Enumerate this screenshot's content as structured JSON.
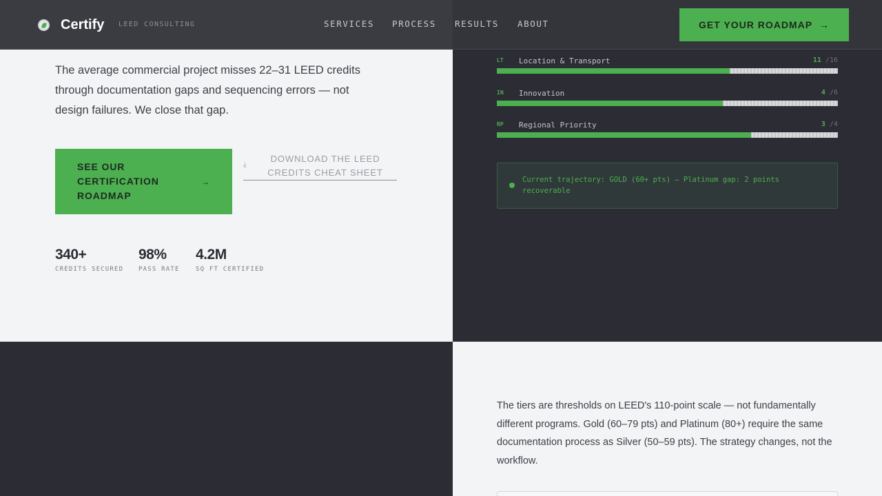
{
  "header": {
    "brand": "Certify",
    "brand_sub": "LEED CONSULTING",
    "nav": [
      "SERVICES",
      "PROCESS",
      "RESULTS",
      "ABOUT"
    ],
    "cta": "GET YOUR ROADMAP",
    "cta_arrow": "→"
  },
  "hero": {
    "lead": "The average commercial project misses 22–31 LEED credits through documentation gaps and sequencing errors — not design failures. We close that gap.",
    "primary_cta": "SEE OUR CERTIFICATION ROADMAP",
    "primary_cta_arrow": "→",
    "download_icon": "⤓",
    "download_link": "DOWNLOAD THE LEED CREDITS CHEAT SHEET",
    "stats": [
      {
        "value": "340+",
        "label": "CREDITS SECURED"
      },
      {
        "value": "98%",
        "label": "PASS RATE"
      },
      {
        "value": "4.2M",
        "label": "SQ FT CERTIFIED"
      }
    ]
  },
  "credits": [
    {
      "code": "LT",
      "name": "Location & Transport",
      "earned": "11",
      "total": "/16",
      "fill_fraction": 0.683
    },
    {
      "code": "IN",
      "name": "Innovation",
      "earned": "4",
      "total": "/6",
      "fill_fraction": 0.663
    },
    {
      "code": "RP",
      "name": "Regional Priority",
      "earned": "3",
      "total": "/4",
      "fill_fraction": 0.745
    }
  ],
  "trajectory": {
    "text": "Current trajectory: GOLD (60+ pts) — Platinum gap: 2 points recoverable"
  },
  "tiers": {
    "text": "The tiers are thresholds on LEED's 110-point scale — not fundamentally different programs. Gold (60–79 pts) and Platinum (80+) require the same documentation process as Silver (50–59 pts). The strategy changes, not the workflow."
  },
  "colors": {
    "accent": "#4caf50",
    "dark": "#2b2c34",
    "light": "#f2f4f6"
  }
}
